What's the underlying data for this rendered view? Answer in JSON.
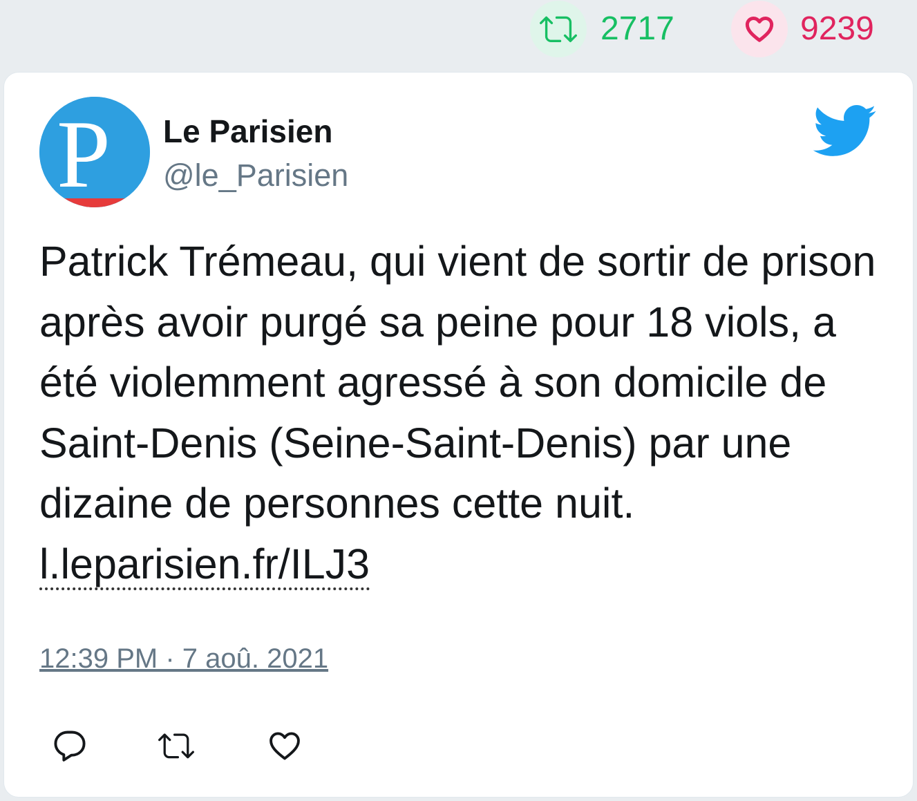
{
  "stats": {
    "retweets": "2717",
    "likes": "9239",
    "retweet_icon": "retweet-icon",
    "like_icon": "heart-icon",
    "retweet_color": "#17bf63",
    "like_color": "#e0245e"
  },
  "tweet": {
    "author_name": "Le Parisien",
    "author_handle": "@le_Parisien",
    "avatar_letter": "P",
    "text": "Patrick Trémeau, qui vient de sortir de prison après avoir purgé sa peine pour 18 viols, a été violemment agressé à son domicile de Saint-Denis (Seine-Saint-Denis) par une dizaine de personnes cette nuit. ",
    "link": "l.leparisien.fr/ILJ3",
    "timestamp": "12:39 PM · 7 aoû. 2021",
    "brand_icon": "twitter-bird-icon",
    "brand_color": "#1da1f2"
  },
  "actions": [
    {
      "icon": "reply-icon"
    },
    {
      "icon": "retweet-icon"
    },
    {
      "icon": "like-icon"
    }
  ]
}
